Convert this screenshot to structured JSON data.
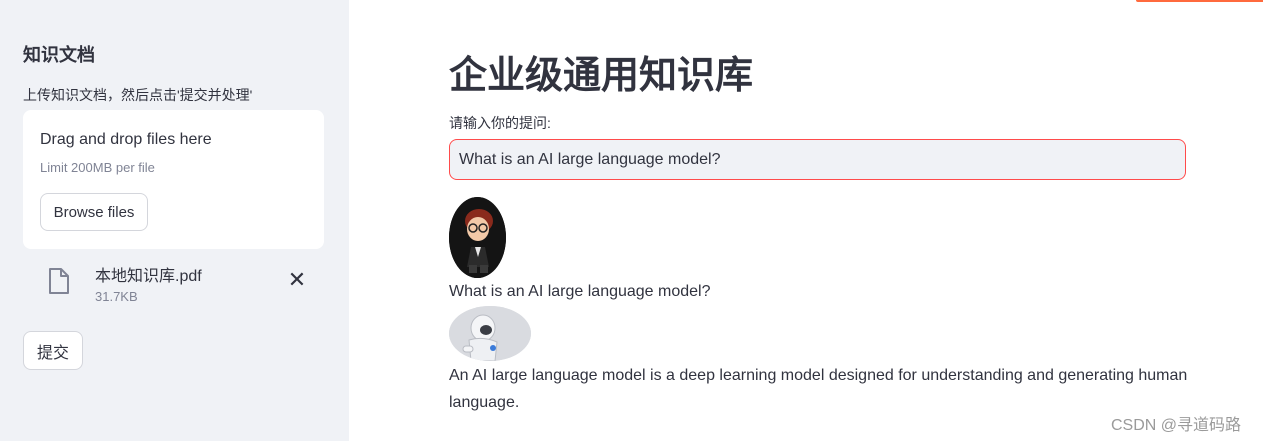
{
  "sidebar": {
    "title": "知识文档",
    "description": "上传知识文档，然后点击'提交并处理'",
    "uploader": {
      "drag_text": "Drag and drop files here",
      "limit_text": "Limit 200MB per file",
      "browse_label": "Browse files"
    },
    "file": {
      "name": "本地知识库.pdf",
      "size": "31.7KB",
      "remove_symbol": "✕"
    },
    "submit_label": "提交"
  },
  "main": {
    "title": "企业级通用知识库",
    "question_label": "请输入你的提问:",
    "question_value": "What is an AI large language model?",
    "chat": [
      {
        "role": "user",
        "text": "What is an AI large language model?"
      },
      {
        "role": "bot",
        "text": "An AI large language model is a deep learning model designed for understanding and generating human language."
      }
    ]
  },
  "watermark": "CSDN @寻道码路",
  "colors": {
    "sidebar_bg": "#f0f2f6",
    "input_focus_border": "#ff4b4b",
    "text": "#31333f",
    "muted": "#808495"
  },
  "icons": {
    "file": "file-icon",
    "remove": "close-icon"
  }
}
